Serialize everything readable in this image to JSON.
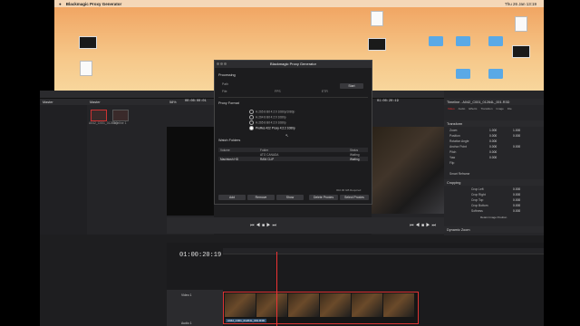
{
  "menubar": {
    "app": "Blackmagic Proxy Generator",
    "clock": "Thu 26 Jan 13:19"
  },
  "desktop": {
    "icons": [
      {
        "label": "",
        "kind": "thumb"
      },
      {
        "label": "",
        "kind": "doc"
      },
      {
        "label": "",
        "kind": "doc"
      },
      {
        "label": "",
        "kind": "thumb"
      },
      {
        "label": "",
        "kind": "folder"
      },
      {
        "label": "",
        "kind": "folder"
      },
      {
        "label": "",
        "kind": "folder"
      },
      {
        "label": "",
        "kind": "doc"
      }
    ]
  },
  "resolve": {
    "media_pool": {
      "title": "Master",
      "bins": [
        "Master"
      ],
      "clips": [
        "A042_C001_01264Q",
        "Timeline 1"
      ]
    },
    "viewer": {
      "zoom": "58%",
      "timecode_left": "00:00:00:01",
      "timecode_right": "01:00:20:19",
      "timeline_name": "Timeline - A042_C001_01264L_001.R3D"
    },
    "inspector": {
      "tabs": [
        "Video",
        "Audio",
        "Effects",
        "Transition",
        "Image",
        "File"
      ],
      "sections": [
        "Transform",
        "Smart Reframe",
        "Cropping",
        "Dynamic Zoom"
      ],
      "transform_rows": [
        {
          "label": "Zoom",
          "x": "1.000",
          "y": "1.000"
        },
        {
          "label": "Position",
          "x": "0.000",
          "y": "0.000"
        },
        {
          "label": "Rotation Angle",
          "x": "0.000",
          "y": ""
        },
        {
          "label": "Anchor Point",
          "x": "0.000",
          "y": "0.000"
        },
        {
          "label": "Pitch",
          "x": "0.000",
          "y": ""
        },
        {
          "label": "Yaw",
          "x": "0.000",
          "y": ""
        },
        {
          "label": "Flip",
          "x": "",
          "y": ""
        }
      ],
      "crop_rows": [
        {
          "label": "Crop Left",
          "v": "0.000"
        },
        {
          "label": "Crop Right",
          "v": "0.000"
        },
        {
          "label": "Crop Top",
          "v": "0.000"
        },
        {
          "label": "Crop Bottom",
          "v": "0.000"
        },
        {
          "label": "Softness",
          "v": "0.000"
        }
      ],
      "retain": "Retain Image Position"
    },
    "timeline": {
      "timecode": "01:00:20:19",
      "track_video": "Video 1",
      "track_audio": "Audio 1",
      "clip_label": "A042_C001_01264L_001.R3D"
    }
  },
  "dialog": {
    "title": "Blackmagic Proxy Generator",
    "processing": "Processing",
    "path_label": "Path",
    "start_btn": "Start",
    "sub_labels": [
      "File",
      "FPS",
      "ETR"
    ],
    "proxy_format": "Proxy Format",
    "formats": [
      {
        "label": "H.265 8 Bit 4:2:0 1080p/1080p",
        "selected": false
      },
      {
        "label": "H.264 8 Bit 4:2:0 1080p",
        "selected": false
      },
      {
        "label": "H.265 8 Bit 4:2:0 1080p",
        "selected": false
      },
      {
        "label": "ProRes 422 Proxy 4:2:2 1080p",
        "selected": true
      }
    ],
    "dnxhr_label": "",
    "watch_folders": "Watch Folders",
    "columns": [
      "Volume",
      "Folder",
      "Status"
    ],
    "rows": [
      {
        "volume": "",
        "folder": "ATO CANADA",
        "status": "Waiting"
      },
      {
        "volume": "Macintosh HD",
        "folder": "RAW CLIP",
        "status": "Waiting"
      }
    ],
    "footer_note": "002.00 GB Required",
    "buttons": [
      "Add",
      "Remove",
      "Show",
      "Delete Proxies",
      "Select Proxies"
    ]
  }
}
